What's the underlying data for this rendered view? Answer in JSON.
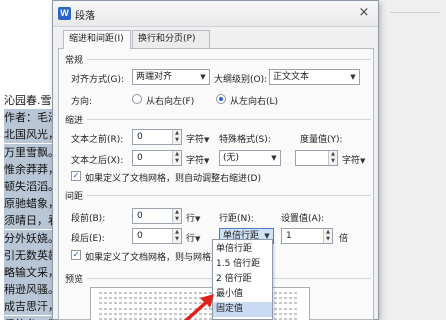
{
  "document": {
    "lines": [
      "沁园春.雪",
      "作者：毛泽",
      "北国风光，",
      "万里雪飘。",
      "惟余莽莽，",
      "顿失滔滔。",
      "原驰蜡象，",
      "须晴日，看",
      "分外妖娆。",
      "引无数英雄",
      "略输文采，",
      "稍逊风骚。",
      "成吉思汗，",
      "俱往矣，数"
    ]
  },
  "dialog": {
    "title": "段落",
    "app_icon": "W",
    "close": "×",
    "tabs": [
      {
        "label": "缩进和间距(I)",
        "active": true
      },
      {
        "label": "换行和分页(P)",
        "active": false
      }
    ],
    "general": {
      "section": "常规",
      "alignment_label": "对齐方式(G):",
      "alignment_value": "两端对齐",
      "outline_label": "大纲级别(O):",
      "outline_value": "正文文本",
      "direction_label": "方向:",
      "rtl_label": "从右向左(F)",
      "ltr_label": "从左向右(L)",
      "direction_selected": "ltr"
    },
    "indent": {
      "section": "缩进",
      "before_label": "文本之前(R):",
      "before_value": "0",
      "before_unit": "字符",
      "after_label": "文本之后(X):",
      "after_value": "0",
      "after_unit": "字符",
      "special_label": "特殊格式(S):",
      "special_value": "(无)",
      "measure_label": "度量值(Y):",
      "measure_unit": "字符",
      "grid_check_label": "如果定义了文档网格，则自动调整右缩进(D)",
      "grid_checked": true
    },
    "spacing": {
      "section": "间距",
      "before_label": "段前(B):",
      "before_value": "0",
      "before_unit": "行",
      "after_label": "段后(E):",
      "after_value": "0",
      "after_unit": "行",
      "line_label": "行距(N):",
      "line_value": "单倍行距",
      "setting_label": "设置值(A):",
      "setting_value": "1",
      "setting_unit": "倍",
      "grid_check_label": "如果定义了文档网格，则与网格对齐",
      "grid_checked": true
    },
    "line_spacing_options": [
      "单倍行距",
      "1.5 倍行距",
      "2 倍行距",
      "最小值",
      "固定值"
    ],
    "line_spacing_hover": "固定值",
    "preview": {
      "section": "预览"
    }
  },
  "colors": {
    "accent": "#2a63c6",
    "highlight": "#c9dbf3",
    "arrow": "#e0201a"
  }
}
